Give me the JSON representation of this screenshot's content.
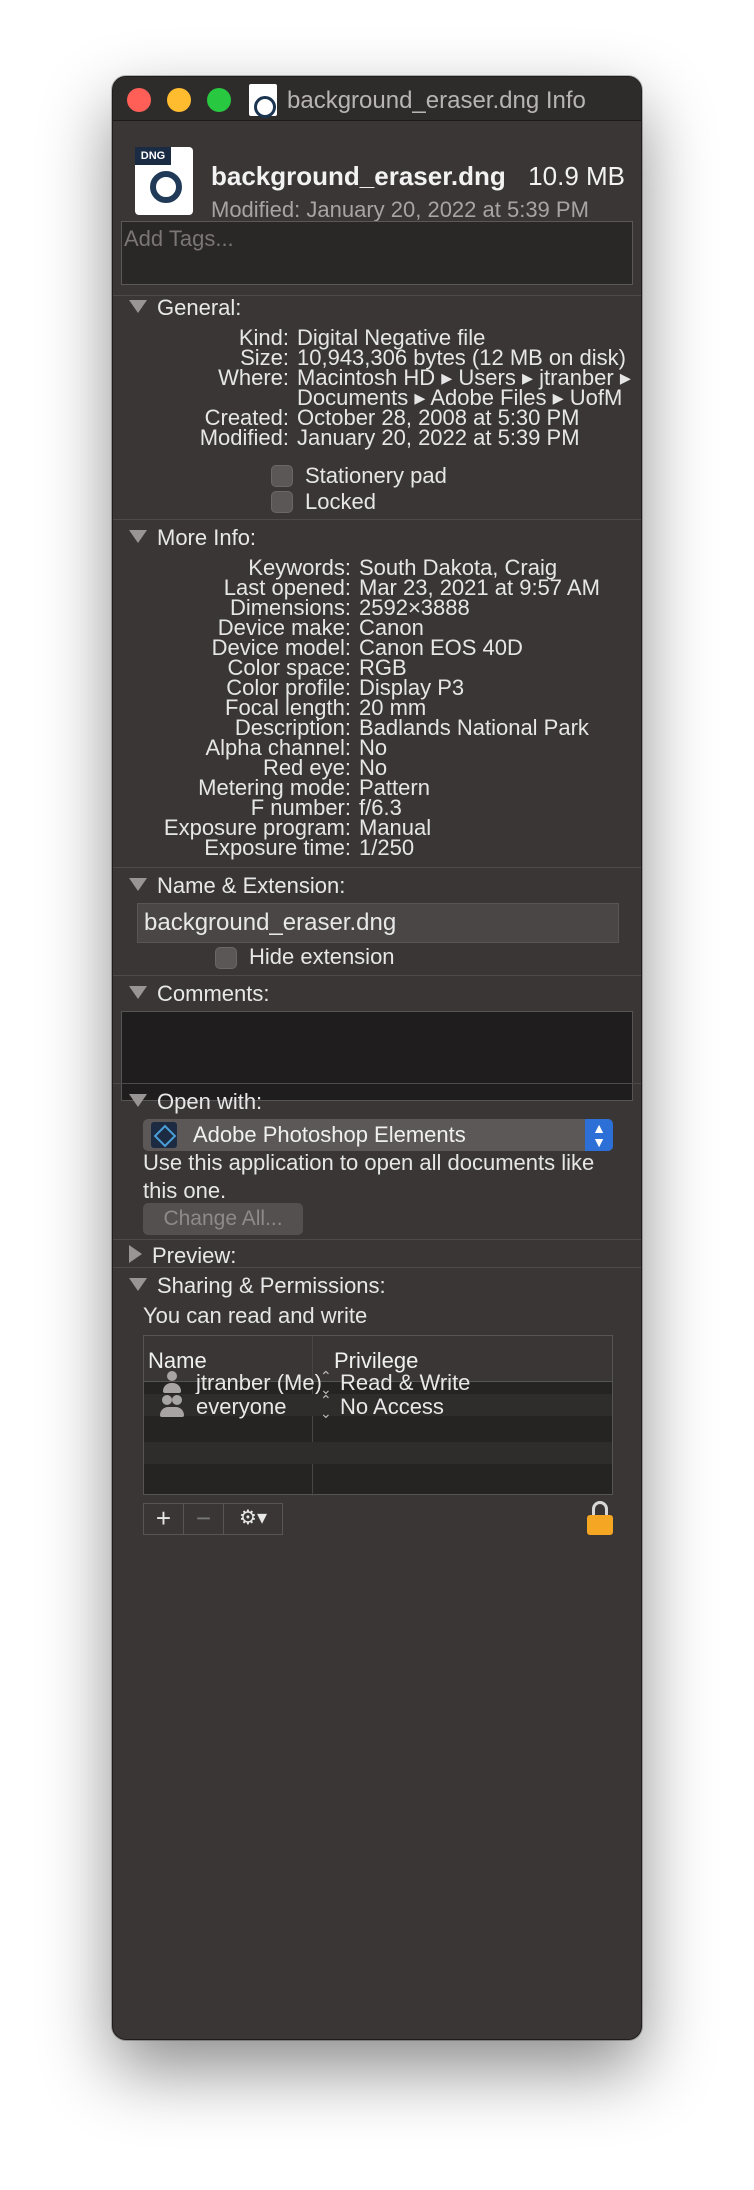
{
  "window": {
    "title": "background_eraser.dng Info"
  },
  "header": {
    "file_name": "background_eraser.dng",
    "size": "10.9 MB",
    "modified": "Modified: January 20, 2022 at 5:39 PM",
    "icon_label": "DNG"
  },
  "tags": {
    "placeholder": "Add Tags..."
  },
  "general": {
    "title": "General:",
    "rows": [
      {
        "label": "Kind:",
        "value": "Digital Negative file"
      },
      {
        "label": "Size:",
        "value": "10,943,306 bytes (12 MB on disk)"
      },
      {
        "label": "Where:",
        "value": "Macintosh HD ▸ Users ▸ jtranber ▸"
      },
      {
        "label": "",
        "value": "Documents ▸ Adobe Files ▸ UofM"
      },
      {
        "label": "Created:",
        "value": "October 28, 2008 at 5:30 PM"
      },
      {
        "label": "Modified:",
        "value": "January 20, 2022 at 5:39 PM"
      }
    ],
    "stationery": "Stationery pad",
    "locked": "Locked"
  },
  "more_info": {
    "title": "More Info:",
    "rows": [
      {
        "label": "Keywords:",
        "value": "South Dakota, Craig"
      },
      {
        "label": "Last opened:",
        "value": "Mar 23, 2021 at 9:57 AM"
      },
      {
        "label": "Dimensions:",
        "value": "2592×3888"
      },
      {
        "label": "Device make:",
        "value": "Canon"
      },
      {
        "label": "Device model:",
        "value": "Canon EOS 40D"
      },
      {
        "label": "Color space:",
        "value": "RGB"
      },
      {
        "label": "Color profile:",
        "value": "Display P3"
      },
      {
        "label": "Focal length:",
        "value": "20 mm"
      },
      {
        "label": "Description:",
        "value": "Badlands National Park"
      },
      {
        "label": "Alpha channel:",
        "value": "No"
      },
      {
        "label": "Red eye:",
        "value": "No"
      },
      {
        "label": "Metering mode:",
        "value": "Pattern"
      },
      {
        "label": "F number:",
        "value": "f/6.3"
      },
      {
        "label": "Exposure program:",
        "value": "Manual"
      },
      {
        "label": "Exposure time:",
        "value": "1/250"
      }
    ]
  },
  "name_ext": {
    "title": "Name & Extension:",
    "value": "background_eraser.dng",
    "hide": "Hide extension"
  },
  "comments": {
    "title": "Comments:"
  },
  "open_with": {
    "title": "Open with:",
    "app": "Adobe Photoshop Elements",
    "description": "Use this application to open all documents like this one.",
    "change_all": "Change All..."
  },
  "preview": {
    "title": "Preview:"
  },
  "sharing": {
    "title": "Sharing & Permissions:",
    "status": "You can read and write",
    "col_name": "Name",
    "col_priv": "Privilege",
    "rows": [
      {
        "name": "jtranber (Me)",
        "privilege": "Read & Write"
      },
      {
        "name": "everyone",
        "privilege": "No Access"
      }
    ]
  },
  "colors": {
    "window_bg": "#3a3636",
    "accent": "#2c6fd6",
    "lock": "#f5a623"
  }
}
